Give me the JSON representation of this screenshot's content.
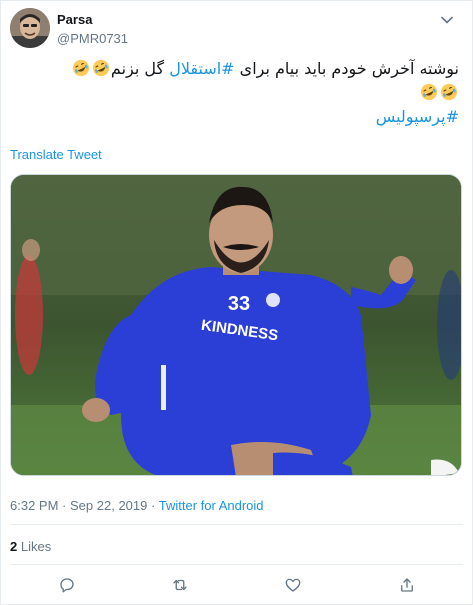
{
  "user": {
    "display_name": "Parsa",
    "handle": "@PMR0731"
  },
  "tweet": {
    "text_part1": "نوشته آخرش خودم باید بیام برای ",
    "hashtag1": "#استقلال",
    "text_part2": " گل بزنم",
    "hashtag2": "#پرسپولیس",
    "emoji": "rolling-on-the-floor-laughing"
  },
  "translate_label": "Translate Tweet",
  "media": {
    "jersey_number": "33",
    "jersey_text": "KINDNESS",
    "jersey_color": "#2b3fd6"
  },
  "meta": {
    "time": "6:32 PM",
    "separator": "·",
    "date": "Sep 22, 2019",
    "source": "Twitter for Android"
  },
  "likes": {
    "count": "2",
    "label": "Likes"
  },
  "actions": {
    "reply_icon": "reply-icon",
    "retweet_icon": "retweet-icon",
    "like_icon": "heart-icon",
    "share_icon": "share-icon"
  },
  "colors": {
    "link": "#1b95e0",
    "text": "#14171a",
    "muted": "#657786",
    "border": "#e6ecf0"
  }
}
